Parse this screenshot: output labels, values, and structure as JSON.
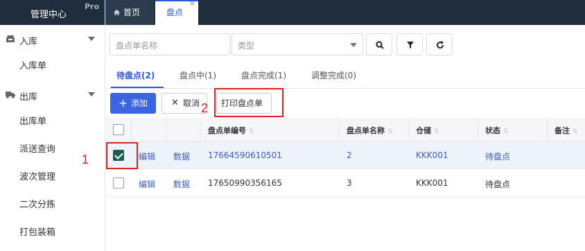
{
  "brand": {
    "title": "管理中心",
    "badge": "Pro"
  },
  "sidebar": {
    "groups": [
      {
        "label": "入库",
        "icon": "inbox-icon",
        "items": [
          "入库单"
        ]
      },
      {
        "label": "出库",
        "icon": "truck-icon",
        "items": [
          "出库单",
          "派送查询",
          "波次管理",
          "二次分拣",
          "打包装箱"
        ]
      }
    ]
  },
  "topTabs": [
    {
      "label": "首页",
      "icon": "home-icon"
    },
    {
      "label": "盘点",
      "closable": true
    }
  ],
  "filters": {
    "name_placeholder": "盘点单名称",
    "type_placeholder": "类型",
    "buttons": [
      "search-icon",
      "filter-icon",
      "refresh-icon"
    ]
  },
  "tabs": [
    {
      "label": "待盘点(2)",
      "active": true
    },
    {
      "label": "盘点中(1)"
    },
    {
      "label": "盘点完成(1)"
    },
    {
      "label": "调整完成(0)"
    }
  ],
  "actions": {
    "add": "添加",
    "cancel": "取消",
    "print": "打印盘点单"
  },
  "table": {
    "columns": [
      "盘点单编号",
      "盘点单名称",
      "仓储",
      "状态",
      "备注"
    ],
    "row_actions": [
      "编辑",
      "数据"
    ],
    "rows": [
      {
        "code": "17664590610501",
        "name": "2",
        "warehouse": "KKK001",
        "status": "待盘点",
        "checked": true
      },
      {
        "code": "17650990356165",
        "name": "3",
        "warehouse": "KKK001",
        "status": "待盘点",
        "checked": false
      }
    ]
  },
  "annotations": {
    "step1": "1",
    "step2": "2"
  },
  "colors": {
    "accent": "#2b59d6",
    "annotation": "#e02020",
    "topbar": "#1f2d3d"
  }
}
